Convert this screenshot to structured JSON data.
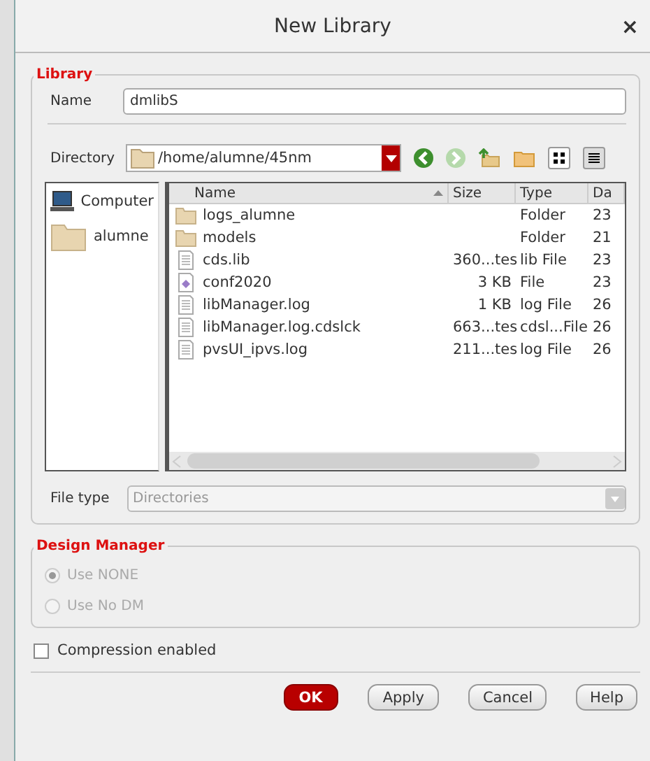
{
  "window": {
    "title": "New Library",
    "close": "×"
  },
  "library": {
    "legend": "Library",
    "name_label": "Name",
    "name_value": "dmlibS",
    "directory_label": "Directory",
    "directory_value": "/home/alumne/45nm",
    "places": [
      {
        "kind": "computer",
        "label": "Computer"
      },
      {
        "kind": "folder",
        "label": "alumne"
      }
    ],
    "columns": [
      "Name",
      "Size",
      "Type",
      "Da"
    ],
    "files": [
      {
        "kind": "folder",
        "name": "logs_alumne",
        "type": "Folder",
        "date": "23"
      },
      {
        "kind": "folder",
        "name": "models",
        "type": "Folder",
        "date": "21"
      },
      {
        "kind": "doc",
        "name": "cds.lib",
        "size": "360...tes",
        "type": "lib File",
        "date": "23"
      },
      {
        "kind": "config",
        "name": "conf2020",
        "size": "3 KB",
        "type": "File",
        "date": "23"
      },
      {
        "kind": "doc",
        "name": "libManager.log",
        "size": "1 KB",
        "type": "log File",
        "date": "26"
      },
      {
        "kind": "doc",
        "name": "libManager.log.cdslck",
        "size": "663...tes",
        "type": "cdsl...File",
        "date": "26"
      },
      {
        "kind": "doc",
        "name": "pvsUI_ipvs.log",
        "size": "211...tes",
        "type": "log File",
        "date": "26"
      }
    ],
    "file_type_label": "File type",
    "file_type_value": "Directories"
  },
  "design_manager": {
    "legend": "Design Manager",
    "disabled": true,
    "options": [
      {
        "label": "Use NONE",
        "selected": true
      },
      {
        "label": "Use No DM",
        "selected": false
      }
    ]
  },
  "compression": {
    "label": "Compression enabled",
    "checked": false
  },
  "buttons": [
    {
      "label": "OK",
      "kind": "primary"
    },
    {
      "label": "Apply",
      "kind": "normal"
    },
    {
      "label": "Cancel",
      "kind": "normal"
    },
    {
      "label": "Help",
      "kind": "normal"
    }
  ]
}
